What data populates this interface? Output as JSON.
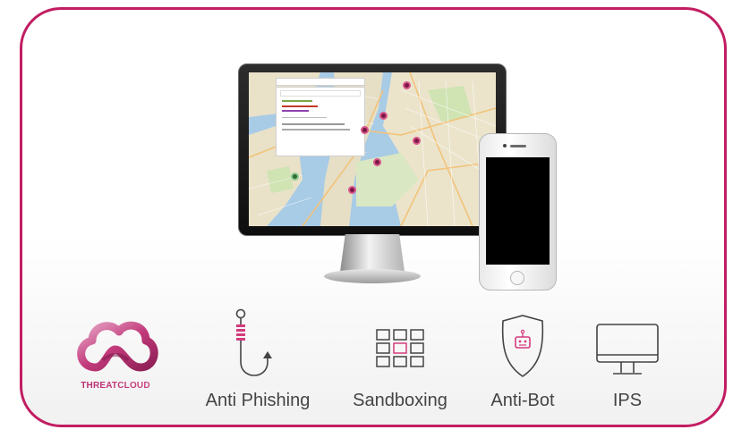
{
  "brand": {
    "logo_text": "THREATCLOUD",
    "accent_color": "#c21d62"
  },
  "devices": {
    "monitor_screen": "map-view",
    "phone_screen": "blank"
  },
  "features": [
    {
      "label": "Anti Phishing",
      "icon": "fishing-hook-icon"
    },
    {
      "label": "Sandboxing",
      "icon": "grid-icon"
    },
    {
      "label": "Anti-Bot",
      "icon": "shield-bot-icon"
    },
    {
      "label": "IPS",
      "icon": "monitor-icon"
    }
  ]
}
